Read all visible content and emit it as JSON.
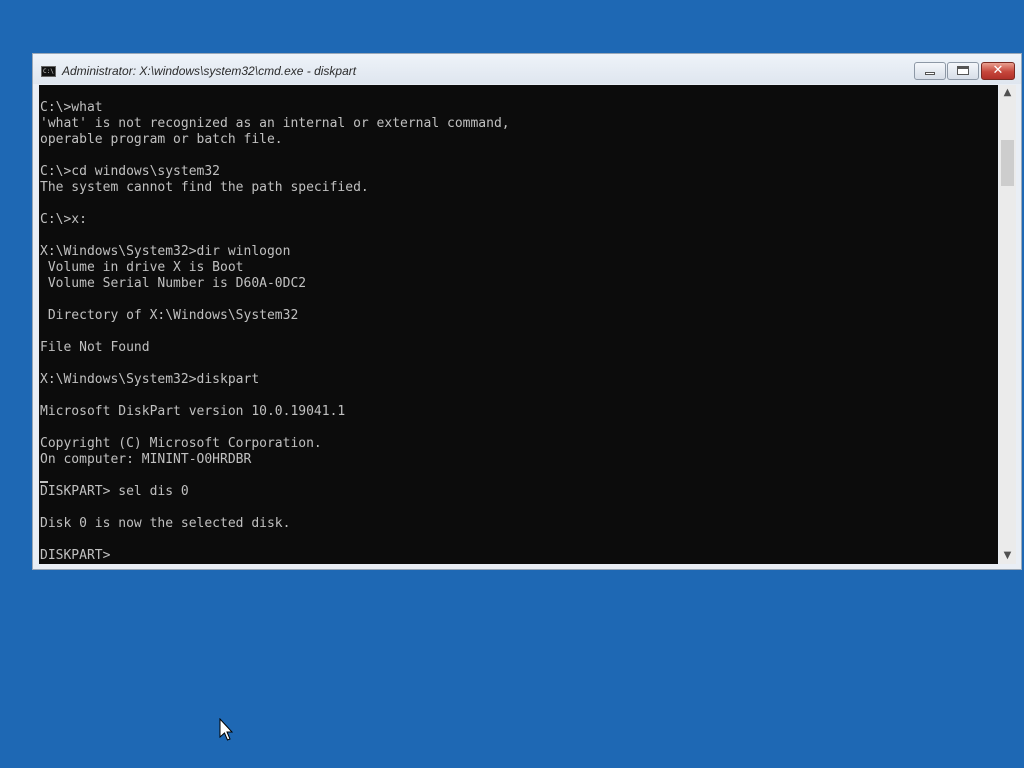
{
  "window": {
    "title": "Administrator: X:\\windows\\system32\\cmd.exe - diskpart",
    "icon_label": "C:\\"
  },
  "console": {
    "lines": [
      "C:\\>what",
      "'what' is not recognized as an internal or external command,",
      "operable program or batch file.",
      "",
      "C:\\>cd windows\\system32",
      "The system cannot find the path specified.",
      "",
      "C:\\>x:",
      "",
      "X:\\Windows\\System32>dir winlogon",
      " Volume in drive X is Boot",
      " Volume Serial Number is D60A-0DC2",
      "",
      " Directory of X:\\Windows\\System32",
      "",
      "File Not Found",
      "",
      "X:\\Windows\\System32>diskpart",
      "",
      "Microsoft DiskPart version 10.0.19041.1",
      "",
      "Copyright (C) Microsoft Corporation.",
      "On computer: MININT-O0HRDBR",
      "",
      "DISKPART> sel dis 0",
      "",
      "Disk 0 is now the selected disk.",
      "",
      "DISKPART> "
    ]
  },
  "icons": {
    "app": "cmd-icon",
    "minimize": "minimize-icon",
    "maximize": "maximize-icon",
    "close": "close-icon",
    "scroll_up": "chevron-up-icon",
    "scroll_down": "chevron-down-icon",
    "pointer": "mouse-pointer-icon"
  },
  "colors": {
    "desktop": "#1e68b4",
    "console_background": "#0c0c0c",
    "console_text": "#c0c0c0",
    "close_button": "#c6463b"
  }
}
